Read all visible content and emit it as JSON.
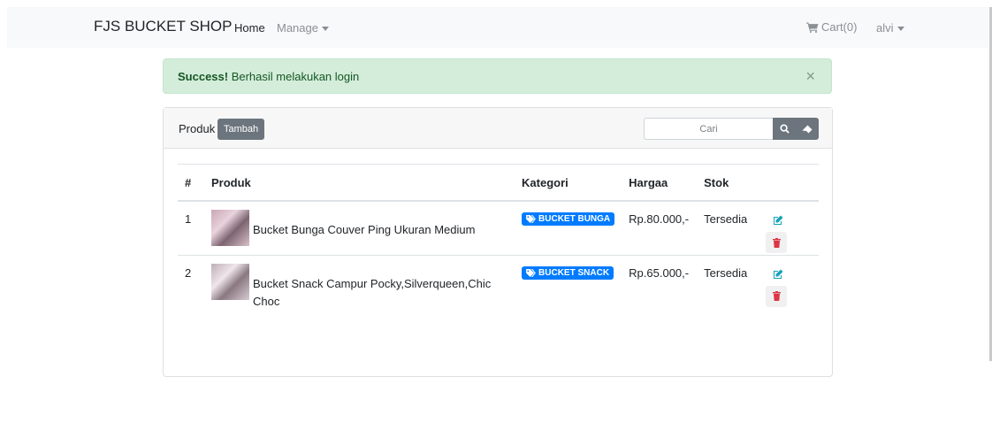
{
  "navbar": {
    "brand": "FJS BUCKET SHOP",
    "home": "Home",
    "manage": "Manage",
    "cart": "Cart(0)",
    "user": "alvi"
  },
  "alert": {
    "strong": "Success!",
    "message": " Berhasil melakukan login",
    "close": "×",
    "color": "#d4edda"
  },
  "card": {
    "title": "Produk",
    "add_button": "Tambah",
    "search_placeholder": "Cari"
  },
  "table": {
    "headers": [
      "#",
      "Produk",
      "Kategori",
      "Hargaa",
      "Stok",
      ""
    ],
    "rows": [
      {
        "no": "1",
        "produk": "Bucket Bunga Couver Ping Ukuran Medium",
        "kategori": "BUCKET BUNGA",
        "harga": "Rp.80.000,-",
        "stok": "Tersedia"
      },
      {
        "no": "2",
        "produk": "Bucket Snack Campur Pocky,Silverqueen,Chic Choc",
        "kategori": "BUCKET SNACK",
        "harga": "Rp.65.000,-",
        "stok": "Tersedia"
      }
    ]
  },
  "icons": {
    "cart": "shopping-cart-icon",
    "search": "search-icon",
    "eraser": "eraser-icon",
    "tag": "tag-icon",
    "edit": "edit-icon",
    "delete": "trash-icon"
  },
  "colors": {
    "primary": "#007bff",
    "secondary": "#6c757d",
    "success_text": "#155724",
    "edit": "#17a2b8",
    "danger": "#dc3545"
  }
}
